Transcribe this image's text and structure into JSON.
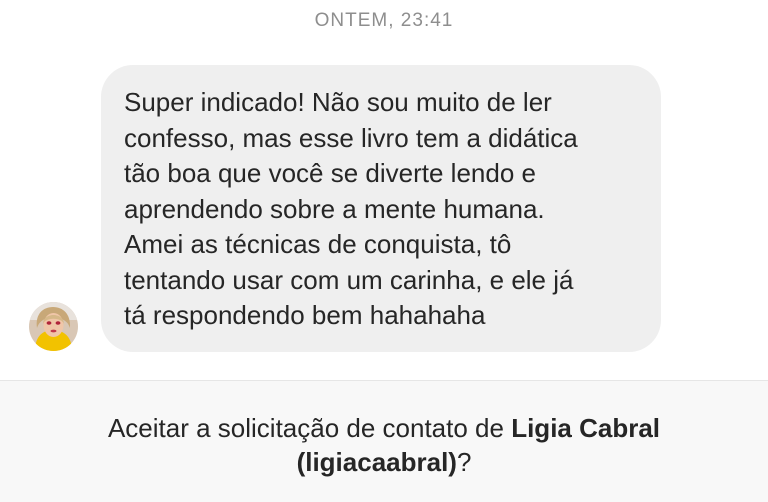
{
  "conversation": {
    "timestamp": "ONTEM, 23:41",
    "message": {
      "lines": [
        "Super indicado! Não sou muito de ler",
        "confesso, mas esse livro tem a didática",
        "tão boa que você se diverte lendo e",
        "aprendendo sobre a mente humana.",
        "Amei as técnicas de conquista, tô",
        "tentando usar com um carinha, e ele já",
        "tá respondendo bem hahahaha"
      ]
    },
    "sender_avatar_icon": "user-avatar"
  },
  "request": {
    "prefix": "Aceitar a solicitação de contato de ",
    "name": "Ligia Cabral",
    "username": "(ligiacaabral)",
    "suffix": "?"
  },
  "colors": {
    "bubble": "#efefef",
    "text": "#262626",
    "timestamp": "#8e8e8e",
    "request_bar": "#f8f8f8"
  }
}
